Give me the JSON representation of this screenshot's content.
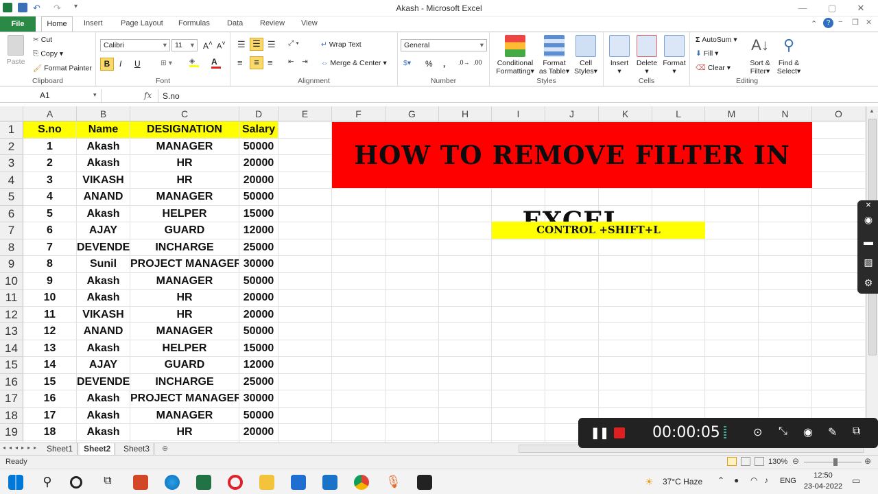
{
  "window": {
    "title": "Akash  -  Microsoft Excel"
  },
  "ribbon_tabs": [
    "File",
    "Home",
    "Insert",
    "Page Layout",
    "Formulas",
    "Data",
    "Review",
    "View"
  ],
  "ribbon": {
    "clipboard": {
      "paste": "Paste",
      "cut": "Cut",
      "copy": "Copy",
      "format_painter": "Format Painter",
      "label": "Clipboard"
    },
    "font": {
      "name": "Calibri",
      "size": "11",
      "bold": "B",
      "italic": "I",
      "underline": "U",
      "label": "Font"
    },
    "alignment": {
      "wrap": "Wrap Text",
      "merge": "Merge & Center",
      "label": "Alignment"
    },
    "number": {
      "format": "General",
      "percent": "%",
      "comma": ",",
      "label": "Number"
    },
    "styles": {
      "conditional": [
        "Conditional",
        "Formatting"
      ],
      "format_table": [
        "Format",
        "as Table"
      ],
      "cell_styles": [
        "Cell",
        "Styles"
      ],
      "label": "Styles"
    },
    "cells": {
      "insert": "Insert",
      "delete": "Delete",
      "format": "Format",
      "label": "Cells"
    },
    "editing": {
      "autosum": "AutoSum",
      "fill": "Fill",
      "clear": "Clear",
      "sort": [
        "Sort &",
        "Filter"
      ],
      "find": [
        "Find &",
        "Select"
      ],
      "label": "Editing"
    }
  },
  "formula_bar": {
    "name_box": "A1",
    "fx": "fx",
    "value": "S.no"
  },
  "columns": [
    "A",
    "B",
    "C",
    "D",
    "E",
    "F",
    "G",
    "H",
    "I",
    "J",
    "K",
    "L",
    "M",
    "N",
    "O"
  ],
  "rows": [
    "1",
    "2",
    "3",
    "4",
    "5",
    "6",
    "7",
    "8",
    "9",
    "10",
    "11",
    "12",
    "13",
    "14",
    "15",
    "16",
    "17",
    "18",
    "19"
  ],
  "table": {
    "headers": [
      "S.no",
      "Name",
      "DESIGNATION",
      "Salary"
    ],
    "rows": [
      [
        "1",
        "Akash",
        "MANAGER",
        "50000"
      ],
      [
        "2",
        "Akash",
        "HR",
        "20000"
      ],
      [
        "3",
        "VIKASH",
        "HR",
        "20000"
      ],
      [
        "4",
        "ANAND",
        "MANAGER",
        "50000"
      ],
      [
        "5",
        "Akash",
        "HELPER",
        "15000"
      ],
      [
        "6",
        "AJAY",
        "GUARD",
        "12000"
      ],
      [
        "7",
        "DEVENDER",
        "INCHARGE",
        "25000"
      ],
      [
        "8",
        "Sunil",
        "PROJECT MANAGER",
        "30000"
      ],
      [
        "9",
        "Akash",
        "MANAGER",
        "50000"
      ],
      [
        "10",
        "Akash",
        "HR",
        "20000"
      ],
      [
        "11",
        "VIKASH",
        "HR",
        "20000"
      ],
      [
        "12",
        "ANAND",
        "MANAGER",
        "50000"
      ],
      [
        "13",
        "Akash",
        "HELPER",
        "15000"
      ],
      [
        "14",
        "AJAY",
        "GUARD",
        "12000"
      ],
      [
        "15",
        "DEVENDER",
        "INCHARGE",
        "25000"
      ],
      [
        "16",
        "Akash",
        "PROJECT MANAGER",
        "30000"
      ],
      [
        "17",
        "Akash",
        "MANAGER",
        "50000"
      ],
      [
        "18",
        "Akash",
        "HR",
        "20000"
      ]
    ]
  },
  "banner": {
    "text": "HOW TO REMOVE FILTER IN EXCEL",
    "color": "#ff0000"
  },
  "shortcut": {
    "text": "CONTROL +SHIFT+L",
    "color": "#ffff00"
  },
  "sheets": [
    "Sheet1",
    "Sheet2",
    "Sheet3"
  ],
  "active_sheet": "Sheet2",
  "status": {
    "ready": "Ready",
    "zoom": "130%"
  },
  "recorder": {
    "time": "00:00:05"
  },
  "taskbar": {
    "weather": "37°C  Haze",
    "lang": "ENG",
    "time": "12:50",
    "date": "23-04-2022"
  }
}
